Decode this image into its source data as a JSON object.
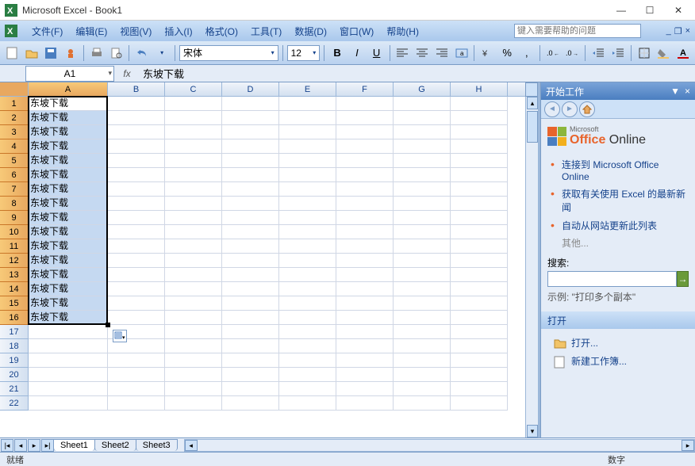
{
  "window": {
    "title": "Microsoft Excel - Book1"
  },
  "menus": {
    "file": "文件(F)",
    "edit": "编辑(E)",
    "view": "视图(V)",
    "insert": "插入(I)",
    "format": "格式(O)",
    "tools": "工具(T)",
    "data": "数据(D)",
    "window": "窗口(W)",
    "help": "帮助(H)"
  },
  "help_placeholder": "键入需要帮助的问题",
  "font": {
    "name": "宋体",
    "size": "12"
  },
  "name_box": "A1",
  "formula_value": "东坡下载",
  "columns": [
    "A",
    "B",
    "C",
    "D",
    "E",
    "F",
    "G",
    "H"
  ],
  "row_count": 22,
  "filled_rows": 16,
  "cell_value": "东坡下载",
  "sheets": {
    "s1": "Sheet1",
    "s2": "Sheet2",
    "s3": "Sheet3"
  },
  "taskpane": {
    "title": "开始工作",
    "logo_small": "Microsoft",
    "logo_main": "Office Online",
    "links": {
      "connect": "连接到 Microsoft Office Online",
      "news": "获取有关使用 Excel 的最新新闻",
      "update": "自动从网站更新此列表",
      "other": "其他..."
    },
    "search_label": "搜索:",
    "example": "示例:  \"打印多个副本\"",
    "open_header": "打开",
    "open_link": "打开...",
    "new_link": "新建工作簿..."
  },
  "status": {
    "ready": "就绪",
    "numlock": "数字"
  }
}
